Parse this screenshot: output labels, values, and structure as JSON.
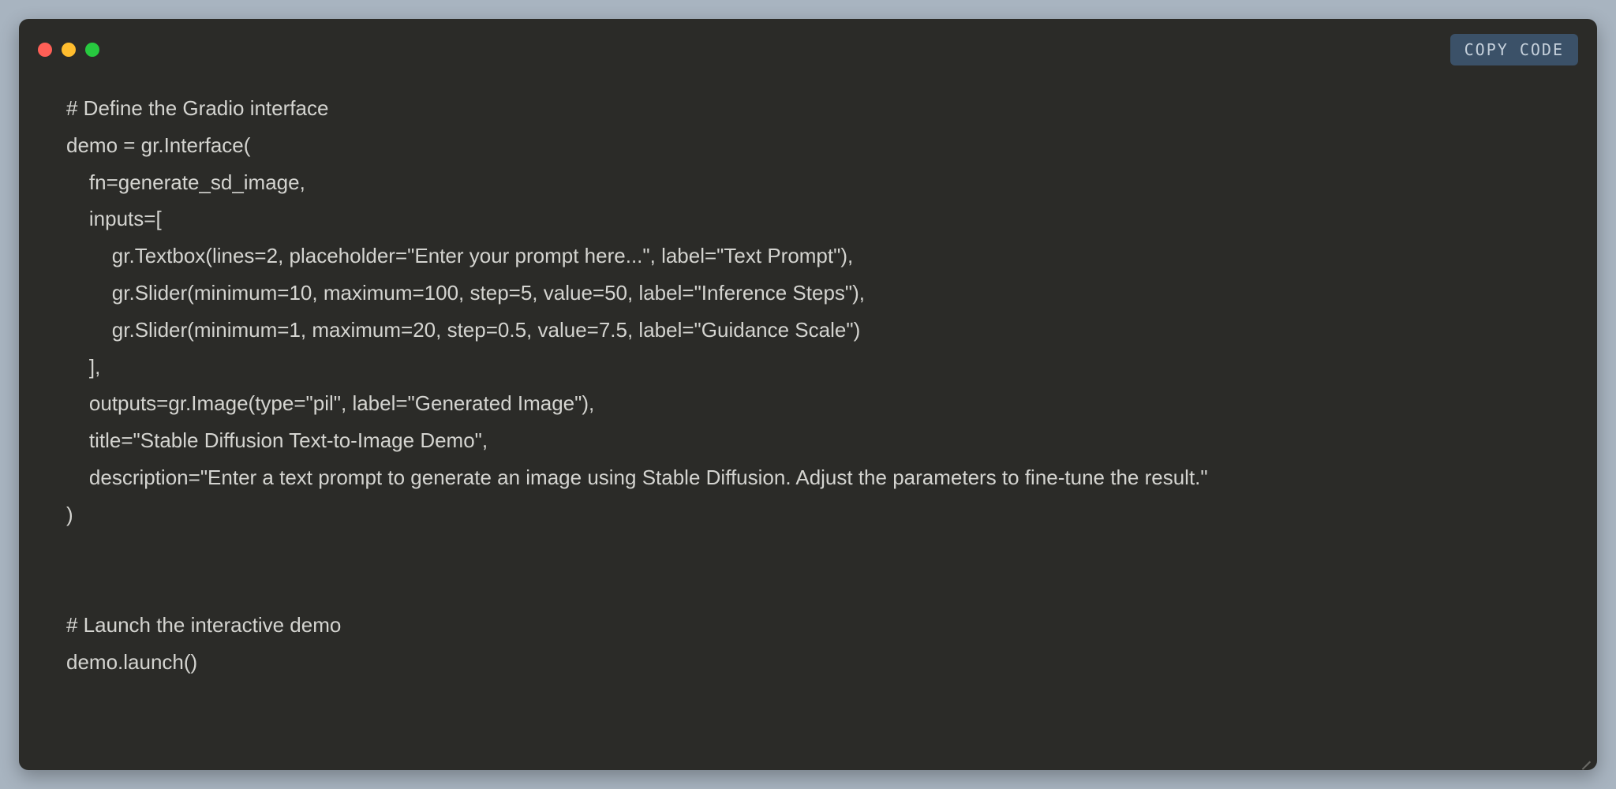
{
  "copy_button_label": "COPY CODE",
  "code_lines": [
    "# Define the Gradio interface",
    "demo = gr.Interface(",
    "    fn=generate_sd_image,",
    "    inputs=[",
    "        gr.Textbox(lines=2, placeholder=\"Enter your prompt here...\", label=\"Text Prompt\"),",
    "        gr.Slider(minimum=10, maximum=100, step=5, value=50, label=\"Inference Steps\"),",
    "        gr.Slider(minimum=1, maximum=20, step=0.5, value=7.5, label=\"Guidance Scale\")",
    "    ],",
    "    outputs=gr.Image(type=\"pil\", label=\"Generated Image\"),",
    "    title=\"Stable Diffusion Text-to-Image Demo\",",
    "    description=\"Enter a text prompt to generate an image using Stable Diffusion. Adjust the parameters to fine-tune the result.\"",
    ")",
    "",
    "",
    "# Launch the interactive demo",
    "demo.launch()"
  ]
}
